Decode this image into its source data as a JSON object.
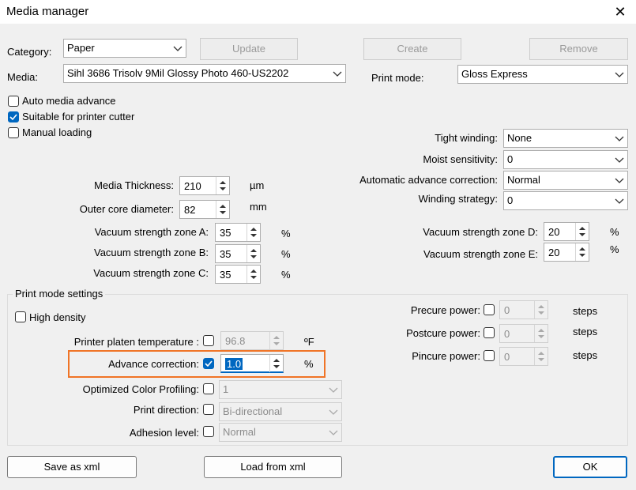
{
  "window": {
    "title": "Media manager",
    "close_symbol": "✕"
  },
  "header": {
    "category_label": "Category:",
    "category_value": "Paper",
    "update_button": "Update",
    "create_button": "Create",
    "remove_button": "Remove",
    "media_label": "Media:",
    "media_value": "Sihl 3686 Trisolv 9Mil Glossy Photo 460-US2202",
    "print_mode_label": "Print mode:",
    "print_mode_value": "Gloss Express"
  },
  "checkboxes": {
    "auto_media_advance": {
      "label": "Auto media advance",
      "checked": false
    },
    "suitable_cutter": {
      "label": "Suitable for printer cutter",
      "checked": true
    },
    "manual_loading": {
      "label": "Manual loading",
      "checked": false
    }
  },
  "right_settings": {
    "tight_winding": {
      "label": "Tight winding:",
      "value": "None"
    },
    "moist_sensitivity": {
      "label": "Moist sensitivity:",
      "value": "0"
    },
    "automatic_advance": {
      "label": "Automatic advance correction:",
      "value": "Normal"
    },
    "winding_strategy": {
      "label": "Winding strategy:",
      "value": "0"
    }
  },
  "media_params": {
    "thickness": {
      "label": "Media Thickness:",
      "value": "210",
      "unit": "µm"
    },
    "outer_core": {
      "label": "Outer core diameter:",
      "value": "82",
      "unit": "mm"
    },
    "vac_a": {
      "label": "Vacuum strength zone A:",
      "value": "35",
      "unit": "%"
    },
    "vac_b": {
      "label": "Vacuum strength zone B:",
      "value": "35",
      "unit": "%"
    },
    "vac_c": {
      "label": "Vacuum strength zone C:",
      "value": "35",
      "unit": "%"
    },
    "vac_d": {
      "label": "Vacuum strength zone D:",
      "value": "20",
      "unit": "%"
    },
    "vac_e": {
      "label": "Vacuum strength zone E:",
      "value": "20",
      "unit": "%"
    }
  },
  "print_mode_settings": {
    "group_label": "Print mode settings",
    "high_density": {
      "label": "High density",
      "checked": false
    },
    "platen_temp": {
      "label": "Printer platen temperature :",
      "value": "96.8",
      "unit": "ºF",
      "checked": false
    },
    "advance_correction": {
      "label": "Advance correction:",
      "value": "1.0",
      "unit": "%",
      "checked": true
    },
    "optimized_color": {
      "label": "Optimized Color Profiling:",
      "value": "1",
      "checked": false
    },
    "print_direction": {
      "label": "Print direction:",
      "value": "Bi-directional",
      "checked": false
    },
    "adhesion_level": {
      "label": "Adhesion level:",
      "value": "Normal",
      "checked": false
    },
    "precure": {
      "label": "Precure power:",
      "value": "0",
      "unit": "steps",
      "checked": false
    },
    "postcure": {
      "label": "Postcure power:",
      "value": "0",
      "unit": "steps",
      "checked": false
    },
    "pincure": {
      "label": "Pincure power:",
      "value": "0",
      "unit": "steps",
      "checked": false
    }
  },
  "footer": {
    "save_xml": "Save as xml",
    "load_xml": "Load from xml",
    "ok": "OK"
  },
  "colors": {
    "accent": "#0067c0",
    "focus_outline": "#f07426"
  }
}
